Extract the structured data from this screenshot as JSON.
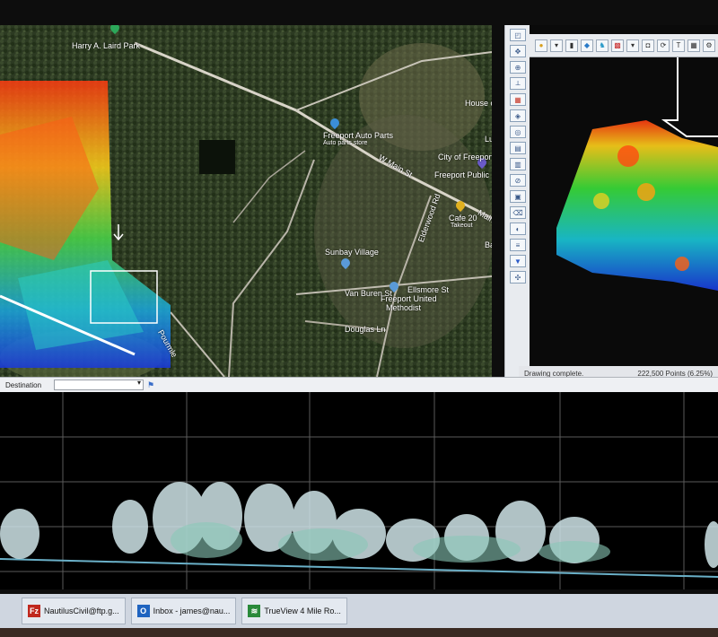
{
  "map": {
    "labels": {
      "park": "Harry A. Laird Park",
      "auto_parts": "Freeport Auto Parts",
      "auto_parts_sub": "Auto parts store",
      "city": "City of Freeport",
      "library": "Freeport Public Libr",
      "house": "House of Ne",
      "luc": "Luc",
      "cafe": "Cafe 20",
      "cafe_sub": "Takeout",
      "sunbay": "Sunbay Village",
      "methodist_1": "Freeport United",
      "methodist_2": "Methodist",
      "road_main": "W Main St",
      "road_main2": "Main",
      "road_elderwood": "Elderwood Rd",
      "road_vanburen": "Van Buren St",
      "road_ellsmore": "Ellsmore St",
      "road_douglas": "Douglas Ln",
      "road_peoples": "Pourmle",
      "road_ba": "Ba"
    }
  },
  "status": {
    "left": "Drawing complete.",
    "right": "222,500 Points (6.25%)"
  },
  "destination": {
    "label": "Destination",
    "value": ""
  },
  "taskbar": [
    {
      "label": "NautilusCivil@ftp.g...",
      "icon": "filezilla-icon",
      "color": "#c0281e",
      "glyph": "Fz"
    },
    {
      "label": "Inbox - james@nau...",
      "icon": "outlook-icon",
      "color": "#1f64c0",
      "glyph": "O"
    },
    {
      "label": "TrueView 4 Mile Ro...",
      "icon": "trueview-icon",
      "color": "#2a8a3a",
      "glyph": "≋"
    }
  ]
}
